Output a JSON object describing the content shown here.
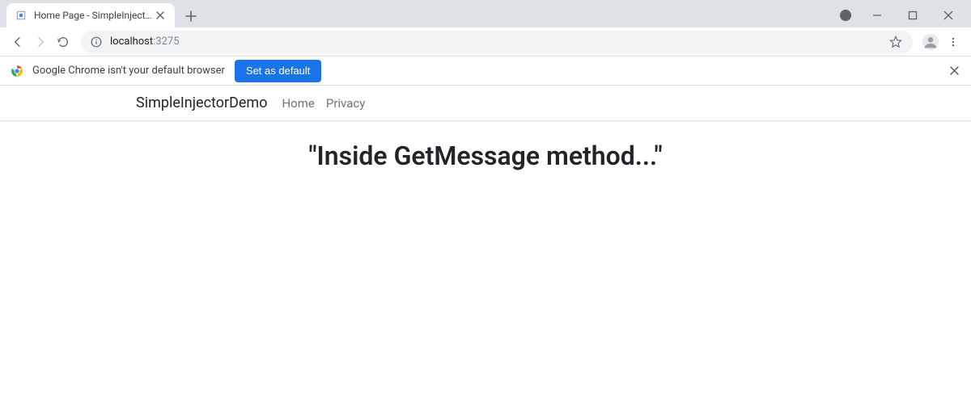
{
  "browser": {
    "tab_title": "Home Page - SimpleInjectorDemo",
    "url_host": "localhost",
    "url_port": ":3275"
  },
  "infobar": {
    "text": "Google Chrome isn't your default browser",
    "button": "Set as default"
  },
  "page": {
    "brand": "SimpleInjectorDemo",
    "nav": {
      "home": "Home",
      "privacy": "Privacy"
    },
    "message": "\"Inside GetMessage method...\""
  }
}
